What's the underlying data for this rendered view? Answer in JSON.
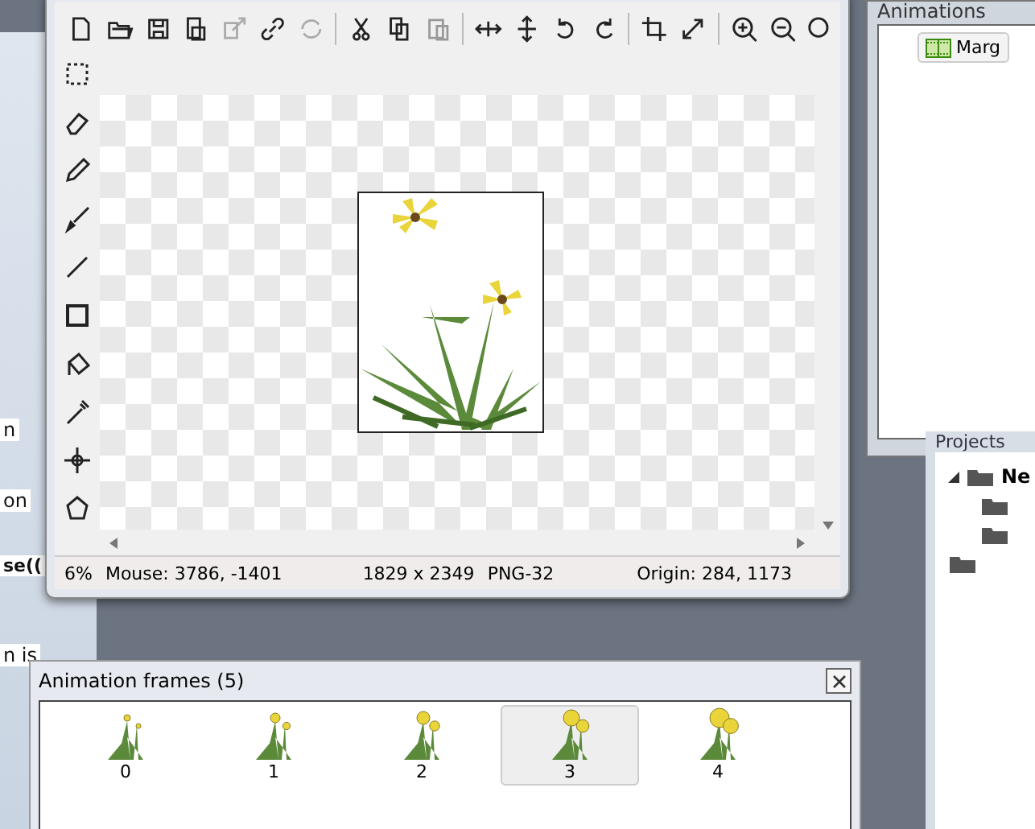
{
  "background_fragments": [
    "n",
    "on",
    "se((",
    "n is"
  ],
  "editor": {
    "tools": [
      {
        "kind": "select",
        "selected": false
      },
      {
        "kind": "eraser",
        "selected": false
      },
      {
        "kind": "pencil",
        "selected": false
      },
      {
        "kind": "brush",
        "selected": false
      },
      {
        "kind": "line",
        "selected": false
      },
      {
        "kind": "rect",
        "selected": false
      },
      {
        "kind": "fill",
        "selected": false
      },
      {
        "kind": "dropper",
        "selected": false
      },
      {
        "kind": "point",
        "selected": false
      },
      {
        "kind": "polygon",
        "selected": false
      }
    ],
    "status_bar": {
      "zoom": "6%",
      "mouse": "Mouse: 3786, -1401",
      "size": "1829 x 2349",
      "format": "PNG-32",
      "origin": "Origin: 284, 1173"
    }
  },
  "animation_frames": {
    "title": "Animation frames (5)",
    "frames": [
      {
        "label": "0",
        "selected": false
      },
      {
        "label": "1",
        "selected": false
      },
      {
        "label": "2",
        "selected": false
      },
      {
        "label": "3",
        "selected": true
      },
      {
        "label": "4",
        "selected": false
      }
    ]
  },
  "animations_panel": {
    "title": "Animations",
    "items": [
      {
        "label": "Marg"
      }
    ]
  },
  "projects_panel": {
    "title": "Projects",
    "root": "Ne"
  }
}
